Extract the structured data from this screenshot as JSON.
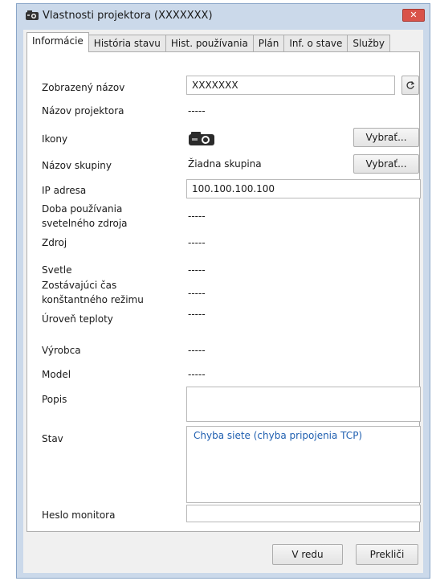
{
  "window": {
    "title": "Vlastnosti projektora (XXXXXXX)",
    "close_glyph": "✕"
  },
  "tabs": [
    {
      "label": "Informácie",
      "active": true
    },
    {
      "label": "História stavu",
      "active": false
    },
    {
      "label": "Hist. používania",
      "active": false
    },
    {
      "label": "Plán",
      "active": false
    },
    {
      "label": "Inf. o stave",
      "active": false
    },
    {
      "label": "Služby",
      "active": false
    }
  ],
  "form": {
    "display_name_label": "Zobrazený názov",
    "display_name_value": "XXXXXXX",
    "projector_name_label": "Názov projektora",
    "projector_name_value": "-----",
    "icons_label": "Ikony",
    "icons_select_button": "Vybrať...",
    "group_name_label": "Názov skupiny",
    "group_name_value": "Žiadna skupina",
    "group_select_button": "Vybrať...",
    "ip_label": "IP adresa",
    "ip_value": "100.100.100.100",
    "light_usage_label_1": "Doba používania",
    "light_usage_label_2": "svetelného zdroja",
    "light_usage_value": "-----",
    "source_label": "Zdroj",
    "source_value": "-----",
    "brightness_label": "Svetle",
    "brightness_value": "-----",
    "const_mode_label_1": "Zostávajúci čas",
    "const_mode_label_2": "konštantného režimu",
    "const_mode_value": "-----",
    "temperature_label": "Úroveň teploty",
    "temperature_value": "-----",
    "manufacturer_label": "Výrobca",
    "manufacturer_value": "-----",
    "model_label": "Model",
    "model_value": "-----",
    "description_label": "Popis",
    "description_value": "",
    "status_label": "Stav",
    "status_value": "Chyba siete (chyba pripojenia TCP)",
    "monitor_password_label": "Heslo monitora",
    "monitor_password_value": ""
  },
  "footer": {
    "ok_button": "V redu",
    "cancel_button": "Prekliči"
  },
  "colors": {
    "status_text": "#1f5fb0",
    "close_button": "#d9534a",
    "window_frame": "#cbd9ea"
  },
  "icons": {
    "title": "projector-icon",
    "refresh": "refresh-icon",
    "projector_thumbnail": "projector-icon"
  }
}
